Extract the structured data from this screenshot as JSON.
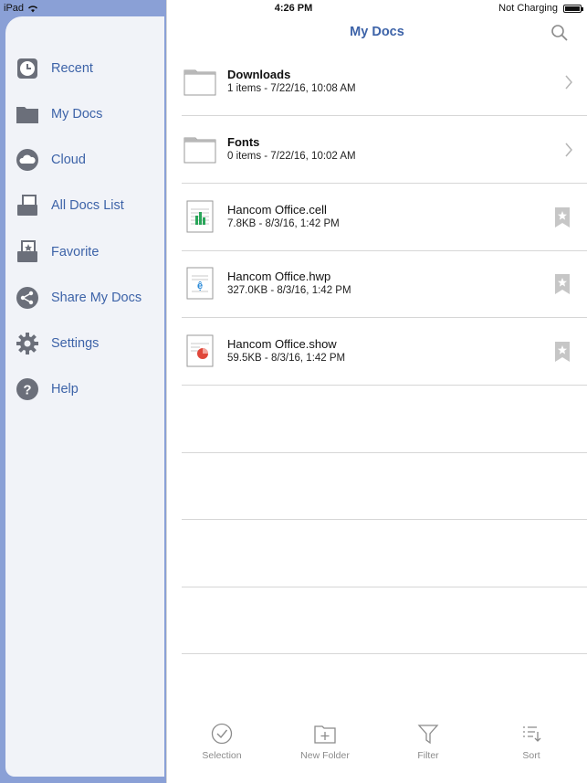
{
  "status_bar": {
    "device": "iPad",
    "time": "4:26 PM",
    "battery_status": "Not Charging"
  },
  "sidebar": {
    "items": [
      {
        "label": "Recent",
        "icon": "clock-icon"
      },
      {
        "label": "My Docs",
        "icon": "folder-icon"
      },
      {
        "label": "Cloud",
        "icon": "cloud-icon"
      },
      {
        "label": "All Docs List",
        "icon": "docs-list-icon"
      },
      {
        "label": "Favorite",
        "icon": "favorite-icon"
      },
      {
        "label": "Share My Docs",
        "icon": "share-icon"
      },
      {
        "label": "Settings",
        "icon": "gear-icon"
      },
      {
        "label": "Help",
        "icon": "help-icon"
      }
    ]
  },
  "header": {
    "title": "My Docs",
    "search_icon": "search-icon"
  },
  "files": [
    {
      "name": "Downloads",
      "meta": "1 items - 7/22/16, 10:08 AM",
      "type": "folder"
    },
    {
      "name": "Fonts",
      "meta": "0 items - 7/22/16, 10:02 AM",
      "type": "folder"
    },
    {
      "name": "Hancom Office.cell",
      "meta": "7.8KB - 8/3/16, 1:42 PM",
      "type": "cell"
    },
    {
      "name": "Hancom Office.hwp",
      "meta": "327.0KB - 8/3/16, 1:42 PM",
      "type": "hwp"
    },
    {
      "name": "Hancom Office.show",
      "meta": "59.5KB - 8/3/16, 1:42 PM",
      "type": "show"
    }
  ],
  "toolbar": {
    "selection": "Selection",
    "new_folder": "New Folder",
    "filter": "Filter",
    "sort": "Sort"
  },
  "colors": {
    "accent": "#3d63a8",
    "sidebar_frame": "#8aa0d6",
    "cell_green": "#2aa65a",
    "hwp_blue": "#2a8ad8",
    "show_red": "#e0473a"
  }
}
